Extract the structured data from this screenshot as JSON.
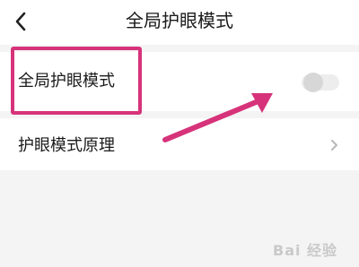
{
  "header": {
    "title": "全局护眼模式"
  },
  "settings": {
    "items": [
      {
        "label": "全局护眼模式",
        "toggle_on": false
      },
      {
        "label": "护眼模式原理"
      }
    ]
  },
  "watermark": {
    "text": "Bai 经验"
  },
  "colors": {
    "highlight": "#d6337a",
    "arrow": "#d6337a"
  }
}
